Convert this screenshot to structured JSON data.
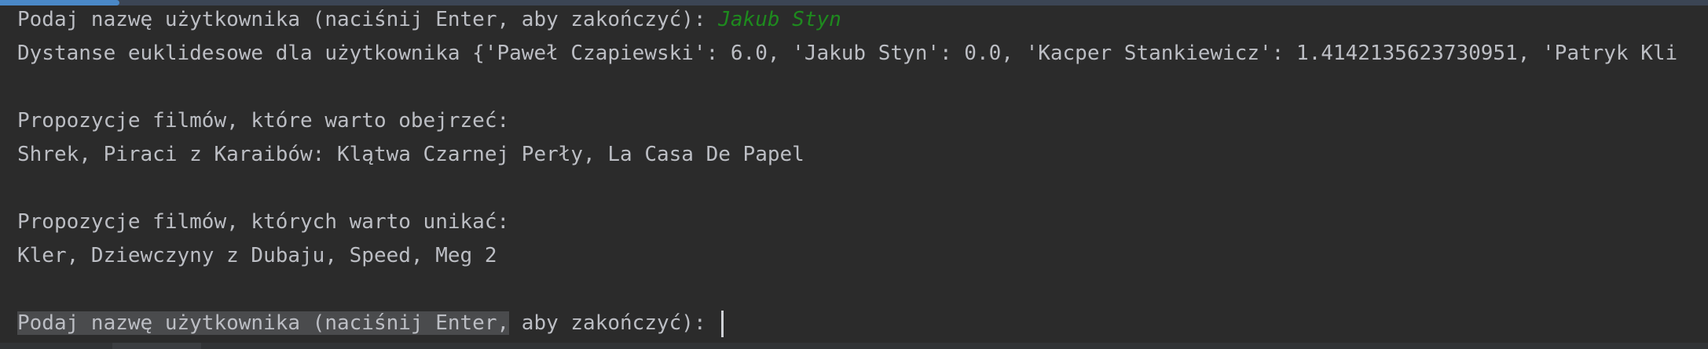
{
  "console": {
    "prompt": "Podaj nazwę użytkownika (naciśnij Enter, aby zakończyć): ",
    "user_input": "Jakub Styn",
    "distances_line": "Dystanse euklidesowe dla użytkownika {'Paweł Czapiewski': 6.0, 'Jakub Styn': 0.0, 'Kacper Stankiewicz': 1.4142135623730951, 'Patryk Kli",
    "recommend_header": "Propozycje filmów, które warto obejrzeć:",
    "recommend_list": "Shrek, Piraci z Karaibów: Klątwa Czarnej Perły, La Casa De Papel",
    "avoid_header": "Propozycje filmów, których warto unikać:",
    "avoid_list": "Kler, Dziewczyny z Dubaju, Speed, Meg 2",
    "prompt2_selected": "Podaj nazwę użytkownika (naciśnij Enter,",
    "prompt2_rest": " aby zakończyć): "
  },
  "colors": {
    "background": "#2b2b2b",
    "text": "#bcbec4",
    "input": "#1e8a1e",
    "progress": "#4a88c7"
  },
  "progress": 0.07
}
